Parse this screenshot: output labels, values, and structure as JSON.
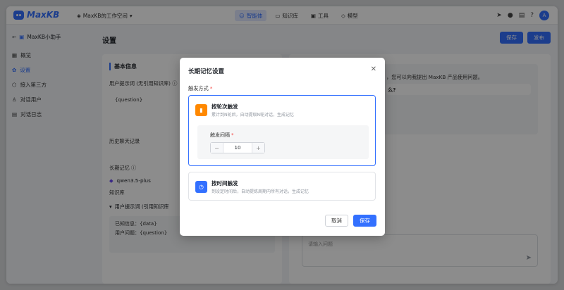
{
  "brand": {
    "name": "MaxKB"
  },
  "workspace": {
    "label": "MaxKB的工作空间"
  },
  "nav": [
    {
      "label": "智能体",
      "icon": "robot-icon",
      "active": true
    },
    {
      "label": "知识库",
      "icon": "book-icon",
      "active": false
    },
    {
      "label": "工具",
      "icon": "toolbox-icon",
      "active": false
    },
    {
      "label": "模型",
      "icon": "cube-icon",
      "active": false
    }
  ],
  "user": {
    "avatar": "A"
  },
  "sidebar": {
    "app_name": "MaxKB小助手",
    "items": [
      {
        "label": "概览",
        "icon": "grid-icon",
        "active": false
      },
      {
        "label": "设置",
        "icon": "gear-icon",
        "active": true
      },
      {
        "label": "接入第三方",
        "icon": "plug-icon",
        "active": false
      },
      {
        "label": "对话用户",
        "icon": "user-icon",
        "active": false
      },
      {
        "label": "对话日志",
        "icon": "log-icon",
        "active": false
      }
    ]
  },
  "main": {
    "title": "设置",
    "save": "保存",
    "publish": "发布",
    "section_title": "基本信息",
    "user_prompt_label": "用户提示词 (无引用知识库) ⓘ",
    "user_prompt_value": "{question}",
    "history_label": "历史聊天记录",
    "long_memory_label": "长期记忆 ⓘ",
    "model_name": "qwen3.5-plus",
    "kb_label": "知识库",
    "kb_prompt_label": "用户提示词 (引用知识库",
    "kb_prompt_line1": "已知信息：{data}",
    "kb_prompt_line2": "用户问题：{question}"
  },
  "chat": {
    "welcome": "，您可以向我提出 MaxKB 产品使用问题。",
    "suggestion": "么?",
    "input_placeholder": "请输入问题"
  },
  "dialog": {
    "title": "长期记忆设置",
    "trigger_label": "触发方式",
    "option1_title": "按轮次触发",
    "option1_desc": "累计到N轮后，自动提取N轮对话，生成记忆",
    "interval_label": "触发间隔",
    "interval_value": "10",
    "option2_title": "按时间触发",
    "option2_desc": "到设定时间后，自动提炼周期内所有对话，生成记忆",
    "cancel": "取消",
    "save": "保存"
  }
}
